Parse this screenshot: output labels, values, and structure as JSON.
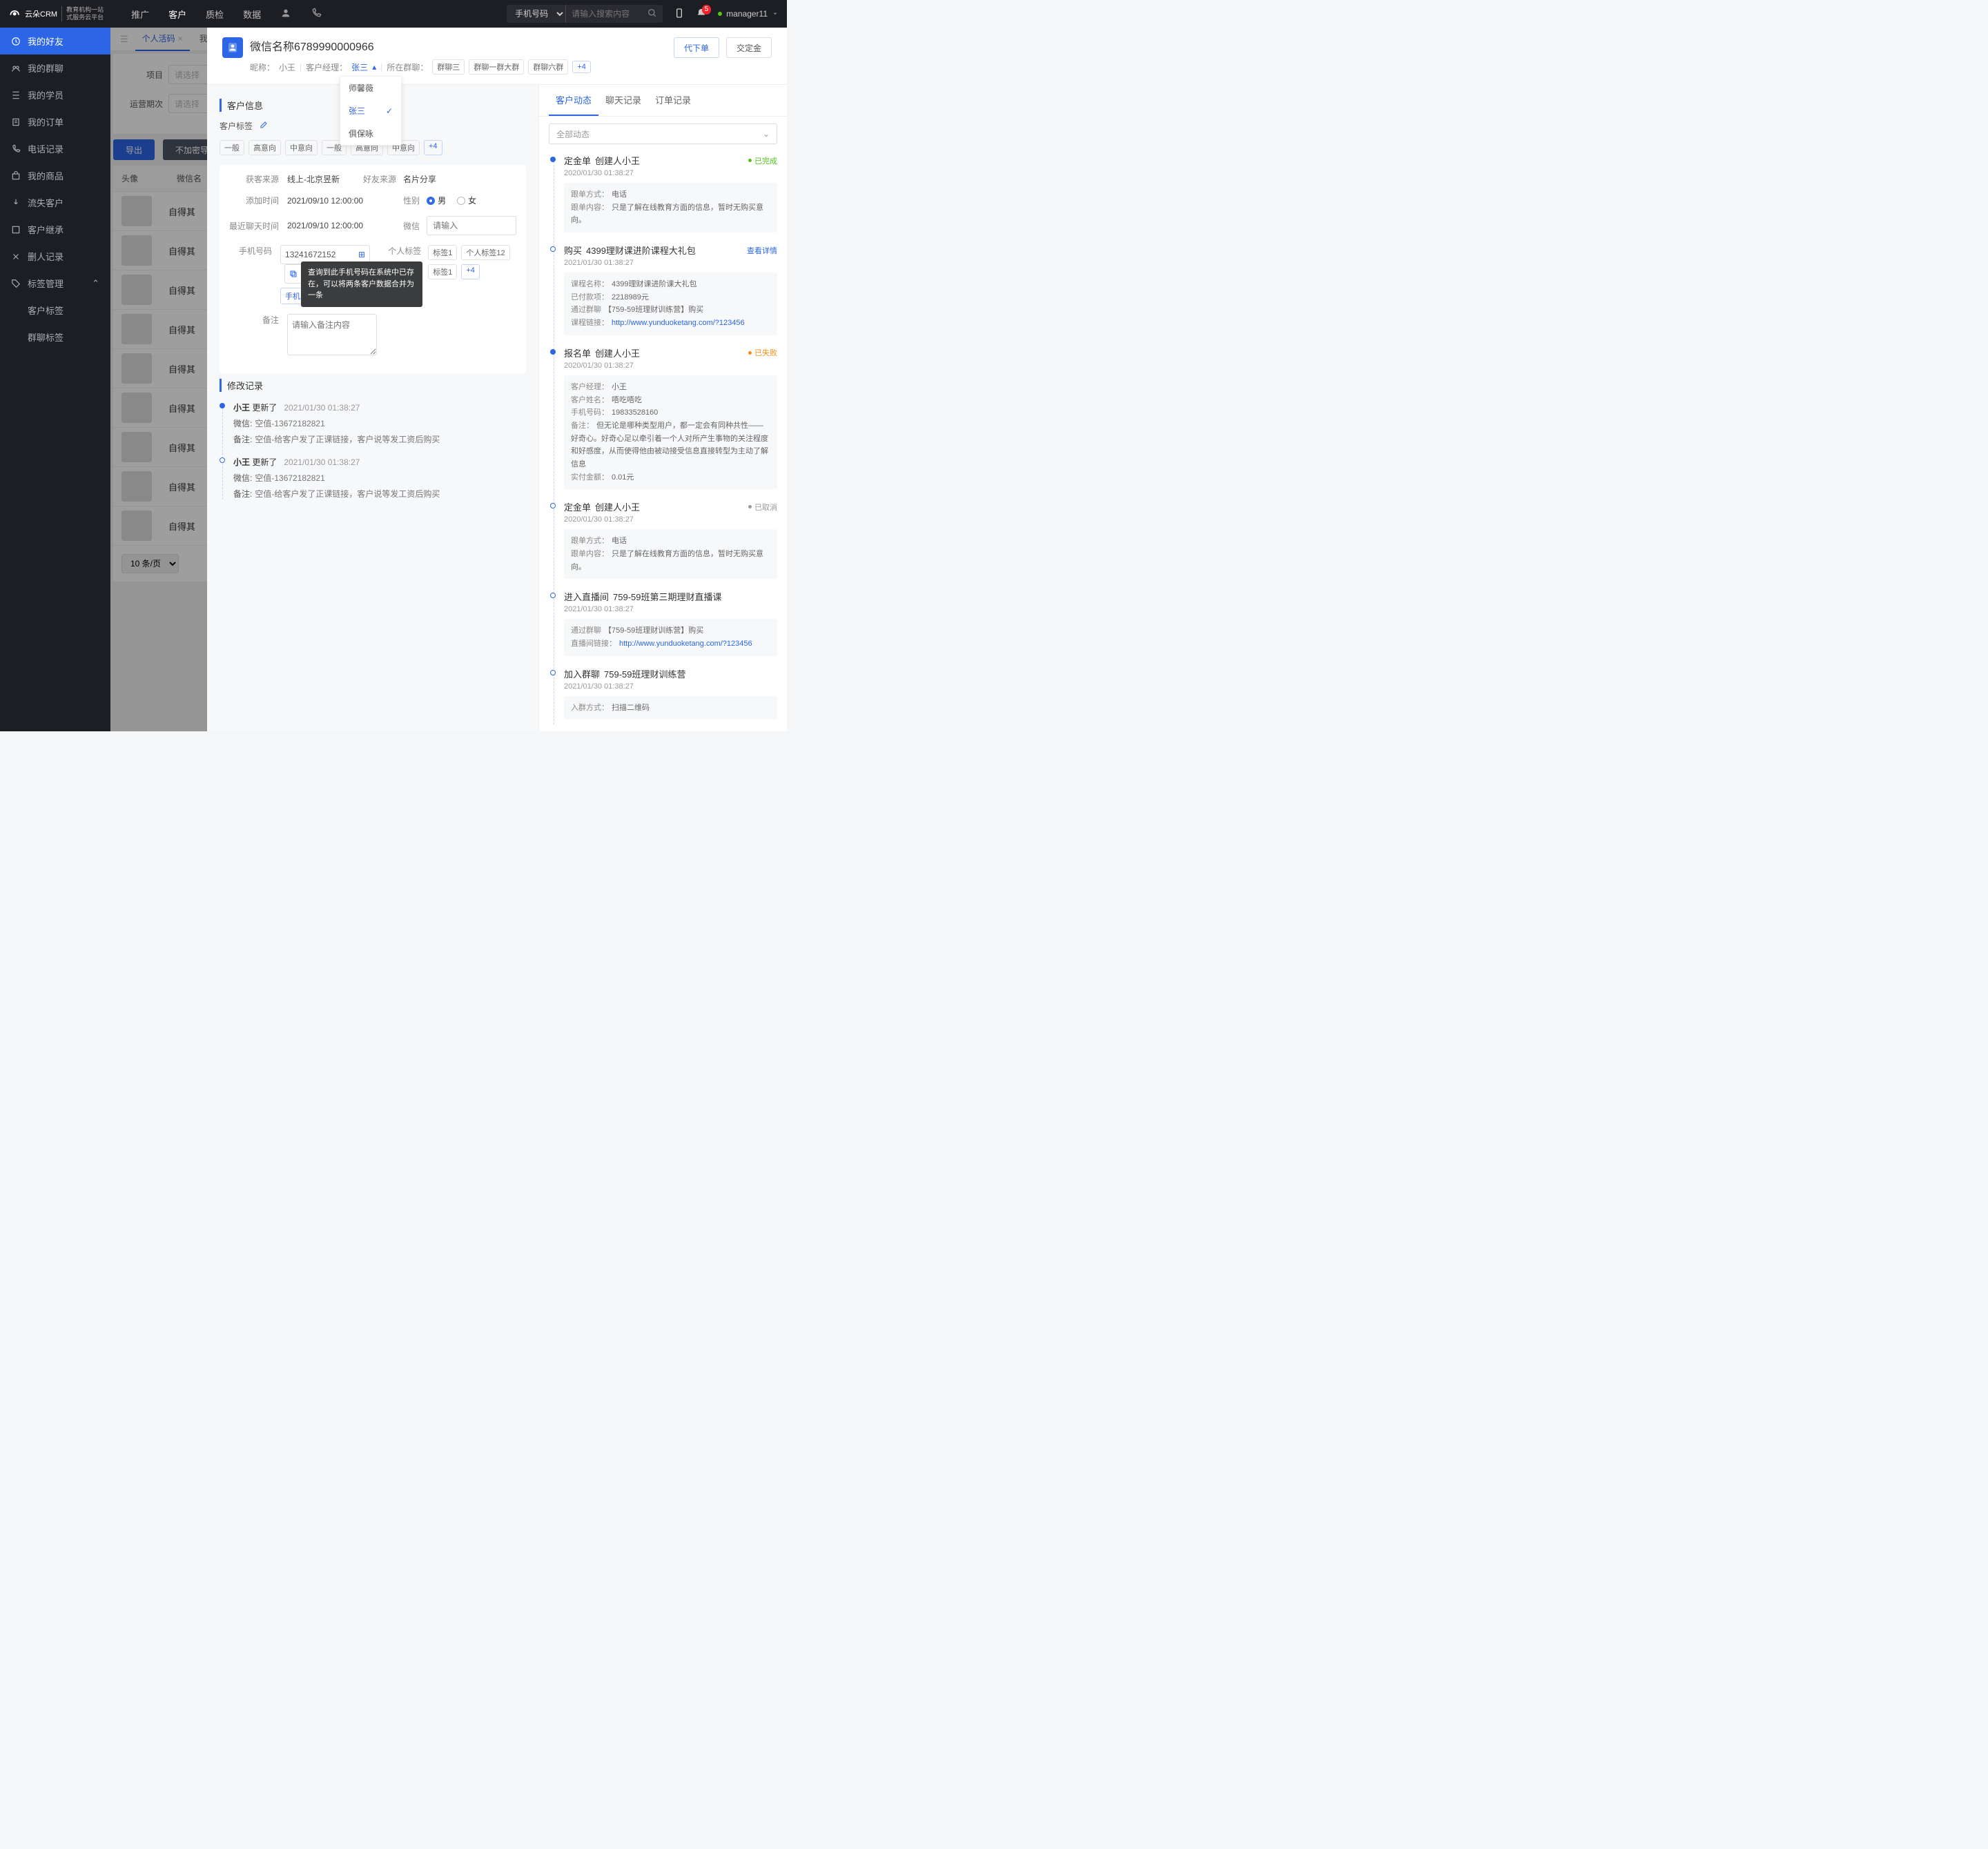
{
  "header": {
    "logo": "云朵CRM",
    "logoSub1": "教育机构一站",
    "logoSub2": "式服务云平台",
    "nav": [
      "推广",
      "客户",
      "质检",
      "数据"
    ],
    "activeNav": 1,
    "searchType": "手机号码",
    "searchPlaceholder": "请输入搜索内容",
    "badge": "5",
    "user": "manager11"
  },
  "leftnav": {
    "items": [
      "我的好友",
      "我的群聊",
      "我的学员",
      "我的订单",
      "电话记录",
      "我的商品",
      "流失客户",
      "客户继承",
      "删人记录",
      "标签管理"
    ],
    "subs": [
      "客户标签",
      "群聊标签"
    ],
    "active": 0
  },
  "main": {
    "tabs": [
      {
        "label": "个人活码"
      },
      {
        "label": "我"
      }
    ],
    "filterLabels": {
      "project": "项目",
      "period": "运营期次",
      "placeholder": "请选择"
    },
    "buttons": {
      "export": "导出",
      "noenc": "不加密导出"
    },
    "tableHeaders": {
      "avatar": "头像",
      "name": "微信名"
    },
    "rows": [
      "自得其",
      "自得其",
      "自得其",
      "自得其",
      "自得其",
      "自得其",
      "自得其",
      "自得其",
      "自得其"
    ],
    "pager": "10 条/页"
  },
  "drawer": {
    "title": "微信名称6789990000966",
    "subLabels": {
      "nick": "昵称：",
      "nickV": "小王",
      "mgr": "客户经理：",
      "mgrV": "张三",
      "groups": "所在群聊："
    },
    "groupChips": [
      "群聊三",
      "群聊一群大群",
      "群聊六群"
    ],
    "groupMore": "+4",
    "actions": {
      "order": "代下单",
      "deposit": "交定金"
    },
    "dropdown": [
      "师馨薇",
      "张三",
      "俱保咏"
    ],
    "dropdownSel": 1,
    "sections": {
      "info": "客户信息",
      "tags": "客户标签",
      "hist": "修改记录"
    },
    "tagList": [
      "一般",
      "高意向",
      "中意向",
      "一般",
      "高意向",
      "中意向"
    ],
    "tagMore": "+4",
    "info": {
      "sourceL": "获客来源",
      "sourceV": "线上-北京昱新",
      "friendL": "好友来源",
      "friendV": "名片分享",
      "addL": "添加时间",
      "addV": "2021/09/10 12:00:00",
      "genderL": "性别",
      "male": "男",
      "female": "女",
      "lastL": "最近聊天时间",
      "lastV": "2021/09/10 12:00:00",
      "wxL": "微信",
      "wxPh": "请输入",
      "phoneL": "手机号码",
      "phoneV": "13241672152",
      "ptagL": "个人标签",
      "ptags": [
        "标签1",
        "个人标签12",
        "标签1"
      ],
      "ptagMore": "+4",
      "phoneChip": "手机",
      "tooltip": "查询到此手机号码在系统中已存在，可以将两条客户数据合并为一条",
      "remarkL": "备注",
      "remarkPh": "请输入备注内容"
    },
    "hist": [
      {
        "who": "小王",
        "act": "更新了",
        "time": "2021/01/30  01:38:27",
        "rows": [
          [
            "微信:",
            "空值-13672182821"
          ],
          [
            "备注:",
            "空值-给客户发了正课链接，客户说等发工资后购买"
          ]
        ]
      },
      {
        "who": "小王",
        "act": "更新了",
        "time": "2021/01/30  01:38:27",
        "rows": [
          [
            "微信:",
            "空值-13672182821"
          ],
          [
            "备注:",
            "空值-给客户发了正课链接，客户说等发工资后购买"
          ]
        ]
      }
    ],
    "right": {
      "tabs": [
        "客户动态",
        "聊天记录",
        "订单记录"
      ],
      "filter": "全部动态",
      "feed": [
        {
          "dot": "solid",
          "title": "定金单",
          "sub": "创建人小王",
          "time": "2020/01/30  01:38:27",
          "status": "已完成",
          "statusCls": "done",
          "card": [
            [
              "跟单方式：",
              "电话"
            ],
            [
              "跟单内容：",
              "只是了解在线教育方面的信息，暂时无购买意向。"
            ]
          ]
        },
        {
          "dot": "hollow",
          "title": "购买",
          "sub": "4399理财课进阶课程大礼包",
          "time": "2021/01/30  01:38:27",
          "detail": "查看详情",
          "card": [
            [
              "课程名称：",
              "4399理财课进阶课大礼包"
            ],
            [
              "已付款项：",
              "2218989元"
            ],
            [
              "通过群聊",
              "【759-59班理财训练营】购买"
            ],
            [
              "课程链接：",
              "http://www.yunduoketang.com/?123456",
              "link"
            ]
          ]
        },
        {
          "dot": "solid",
          "title": "报名单",
          "sub": "创建人小王",
          "time": "2020/01/30  01:38:27",
          "status": "已失败",
          "statusCls": "fail",
          "card": [
            [
              "客户经理：",
              "小王"
            ],
            [
              "客户姓名：",
              "唔吃唔吃"
            ],
            [
              "手机号码：",
              "19833528160"
            ],
            [
              "备注：",
              "但无论是哪种类型用户，都一定会有同种共性——好奇心。好奇心足以牵引着一个人对所产生事物的关注程度和好感度，从而使得他由被动接受信息直接转型为主动了解信息"
            ],
            [
              "实付金额：",
              "0.01元"
            ]
          ]
        },
        {
          "dot": "hollow",
          "title": "定金单",
          "sub": "创建人小王",
          "time": "2020/01/30  01:38:27",
          "status": "已取消",
          "statusCls": "cancel",
          "card": [
            [
              "跟单方式：",
              "电话"
            ],
            [
              "跟单内容：",
              "只是了解在线教育方面的信息，暂时无购买意向。"
            ]
          ]
        },
        {
          "dot": "hollow",
          "title": "进入直播间",
          "sub": "759-59班第三期理财直播课",
          "time": "2021/01/30  01:38:27",
          "card": [
            [
              "通过群聊",
              "【759-59班理财训练营】购买"
            ],
            [
              "直播间链接：",
              "http://www.yunduoketang.com/?123456",
              "link"
            ]
          ]
        },
        {
          "dot": "hollow",
          "title": "加入群聊",
          "sub": "759-59班理财训练营",
          "time": "2021/01/30  01:38:27",
          "card": [
            [
              "入群方式：",
              "扫描二维码"
            ]
          ]
        }
      ]
    }
  }
}
